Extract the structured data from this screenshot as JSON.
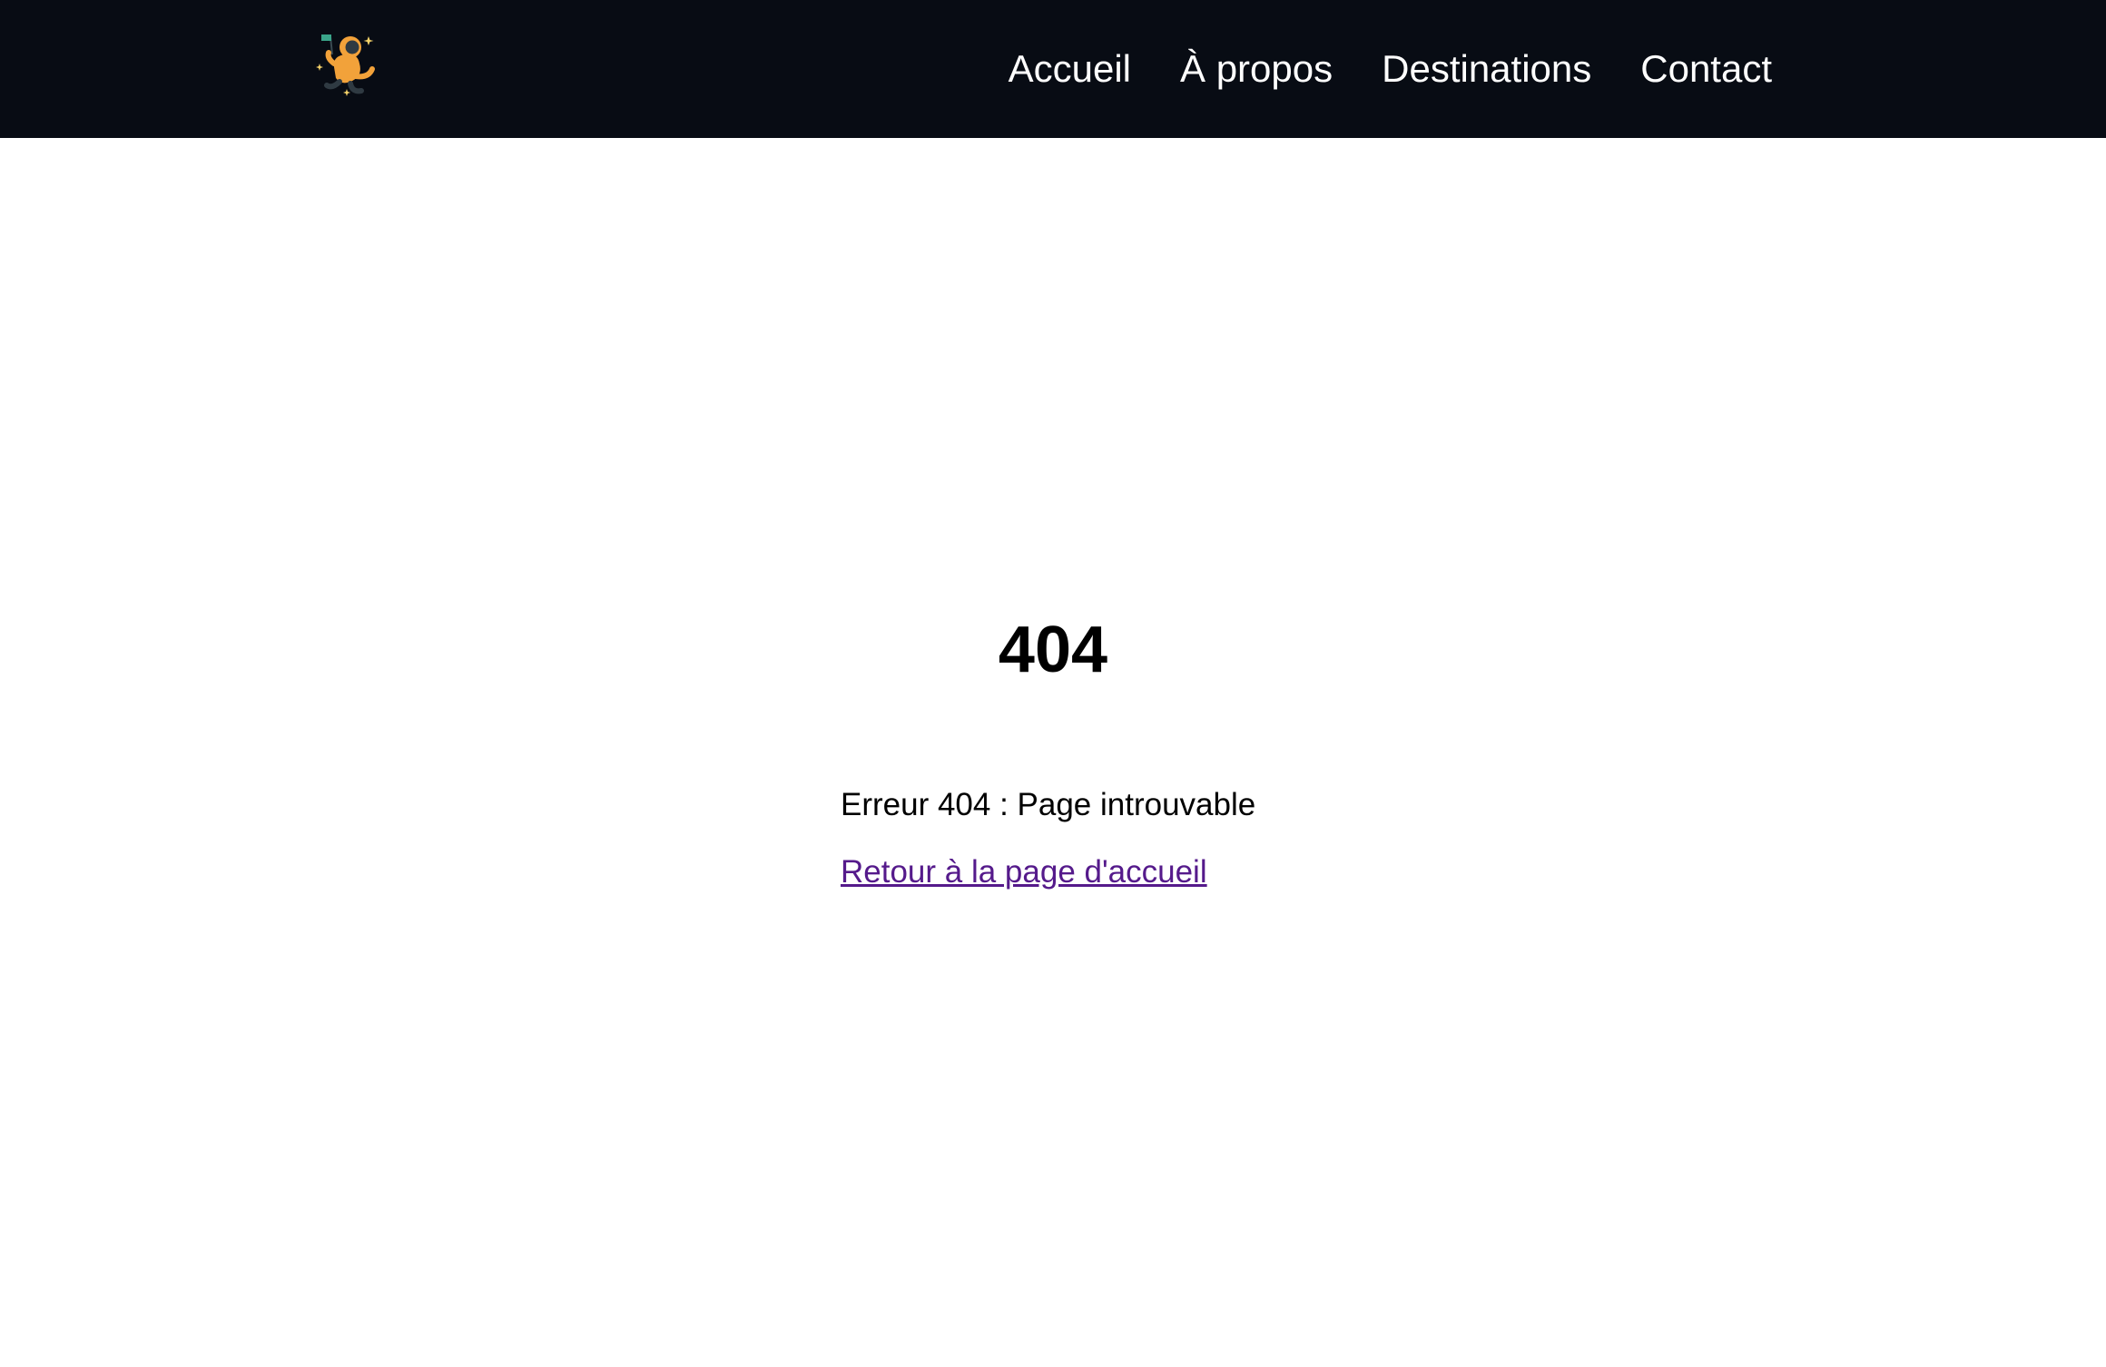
{
  "header": {
    "logo_icon": "astronaut-icon",
    "background_color": "#080c14",
    "nav": [
      {
        "label": "Accueil"
      },
      {
        "label": "À propos"
      },
      {
        "label": "Destinations"
      },
      {
        "label": "Contact"
      }
    ]
  },
  "main": {
    "title": "404",
    "message": "Erreur 404 : Page introuvable",
    "home_link": "Retour à la page d'accueil",
    "link_color": "#551a8b"
  }
}
